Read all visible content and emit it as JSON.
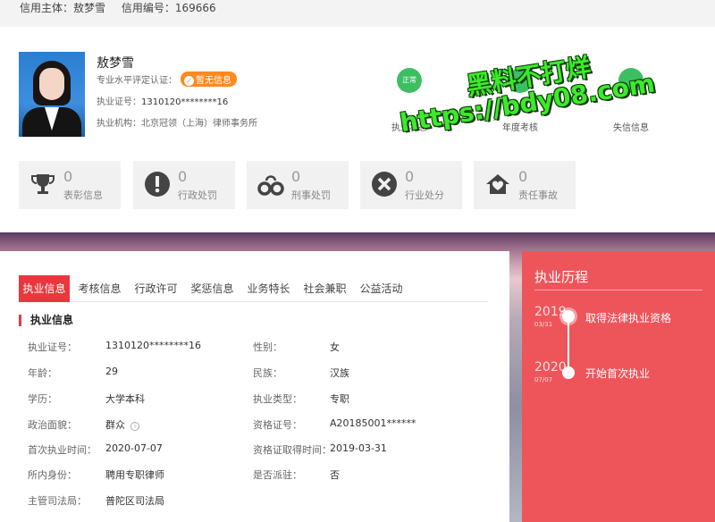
{
  "topbar": {
    "subject_label": "信用主体：敖梦雪",
    "code_label": "信用编号：169666"
  },
  "profile": {
    "name": "敖梦雪",
    "level_label": "专业水平评定认证：",
    "level_badge": "暂无信息",
    "license_label": "执业证号：",
    "license_value": "1310120********16",
    "org_label": "执业机构：北京冠领（上海）律师事务所"
  },
  "statuses": [
    {
      "dot": "正常",
      "label": "执业状态",
      "color": "#3cbf63"
    },
    {
      "dot": "",
      "label": "年度考核",
      "color": "#3cbf63"
    },
    {
      "dot": "",
      "label": "失信信息",
      "color": "#3cbf63"
    }
  ],
  "watermark": {
    "line1": "黑料不打烊",
    "line2": "https://bdy08.com"
  },
  "cards": [
    {
      "icon": "trophy-icon",
      "count": "0",
      "label": "表彰信息"
    },
    {
      "icon": "exclamation-icon",
      "count": "0",
      "label": "行政处罚"
    },
    {
      "icon": "handcuffs-icon",
      "count": "0",
      "label": "刑事处罚"
    },
    {
      "icon": "close-circle-icon",
      "count": "0",
      "label": "行业处分"
    },
    {
      "icon": "house-heart-icon",
      "count": "0",
      "label": "责任事故"
    }
  ],
  "tabs": [
    "执业信息",
    "考核信息",
    "行政许可",
    "奖惩信息",
    "业务特长",
    "社会兼职",
    "公益活动"
  ],
  "section_title": "执业信息",
  "fields": {
    "license_no": {
      "label": "执业证号：",
      "value": "1310120********16"
    },
    "gender": {
      "label": "性别：",
      "value": "女"
    },
    "age": {
      "label": "年龄：",
      "value": "29"
    },
    "ethnicity": {
      "label": "民族：",
      "value": "汉族"
    },
    "education": {
      "label": "学历：",
      "value": "大学本科"
    },
    "practice_type": {
      "label": "执业类型：",
      "value": "专职"
    },
    "politics": {
      "label": "政治面貌：",
      "value": "群众"
    },
    "qualification_no": {
      "label": "资格证号：",
      "value": "A20185001******"
    },
    "first_practice": {
      "label": "首次执业时间：",
      "value": "2020-07-07"
    },
    "qualification_date": {
      "label": "资格证取得时间：",
      "value": "2019-03-31"
    },
    "identity": {
      "label": "所内身份：",
      "value": "聘用专职律师"
    },
    "dispatched": {
      "label": "是否派驻：",
      "value": "否"
    },
    "authority": {
      "label": "主管司法局：",
      "value": "普陀区司法局"
    }
  },
  "history": {
    "title": "执业历程",
    "events": [
      {
        "year": "2019",
        "date": "03/31",
        "text": "取得法律执业资格"
      },
      {
        "year": "2020",
        "date": "07/07",
        "text": "开始首次执业"
      }
    ]
  }
}
